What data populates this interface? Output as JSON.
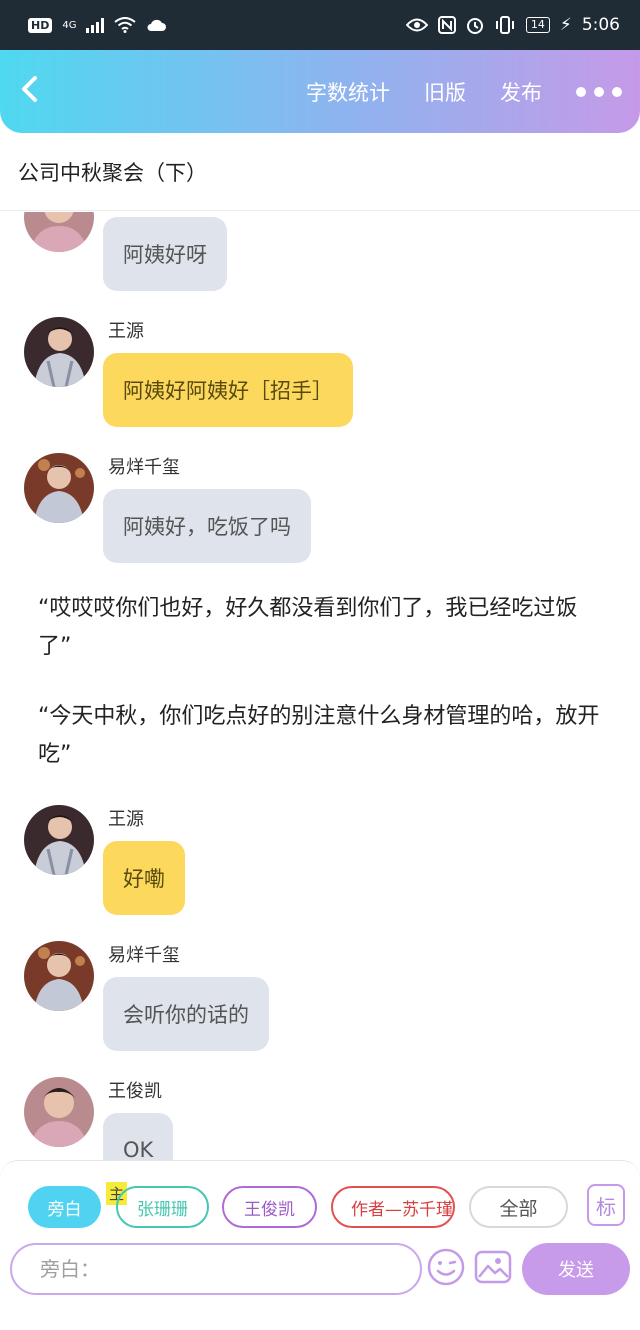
{
  "status_bar": {
    "hd": "HD",
    "network": "4G",
    "battery": "14",
    "time": "5:06"
  },
  "header": {
    "back_icon": "chevron-left-icon",
    "actions": [
      "字数统计",
      "旧版",
      "发布"
    ],
    "more_icon": "more-dots-icon"
  },
  "title": "公司中秋聚会（下）",
  "colors": {
    "header_gradient_start": "#4fd8f0",
    "header_gradient_end": "#c59ae8",
    "bubble_grey": "#dfe4ec",
    "bubble_yellow": "#fcd95c",
    "narrator_chip": "#4fd3f0",
    "send_button": "#c79aea"
  },
  "messages": [
    {
      "speaker": "",
      "text": "阿姨好呀",
      "style": "grey"
    },
    {
      "speaker": "王源",
      "text": "阿姨好阿姨好［招手］",
      "style": "yellow"
    },
    {
      "speaker": "易烊千玺",
      "text": "阿姨好，吃饭了吗",
      "style": "grey"
    },
    {
      "speaker": "王源",
      "text": "好嘞",
      "style": "yellow"
    },
    {
      "speaker": "易烊千玺",
      "text": "会听你的话的",
      "style": "grey"
    },
    {
      "speaker": "王俊凯",
      "text": "OK",
      "style": "grey"
    }
  ],
  "narration": [
    "“哎哎哎你们也好，好久都没看到你们了，我已经吃过饭了”",
    "“今天中秋，你们吃点好的别注意什么身材管理的哈，放开吃”"
  ],
  "roles": {
    "narrator": "旁白",
    "main_tag": "主",
    "zhang": "张珊珊",
    "wang": "王俊凯",
    "author": "作者—苏千瑾",
    "all": "全部",
    "mark": "标"
  },
  "composer": {
    "placeholder": "旁白：",
    "emoji_icon": "emoji-smile-icon",
    "image_icon": "image-icon",
    "send_label": "发送"
  }
}
